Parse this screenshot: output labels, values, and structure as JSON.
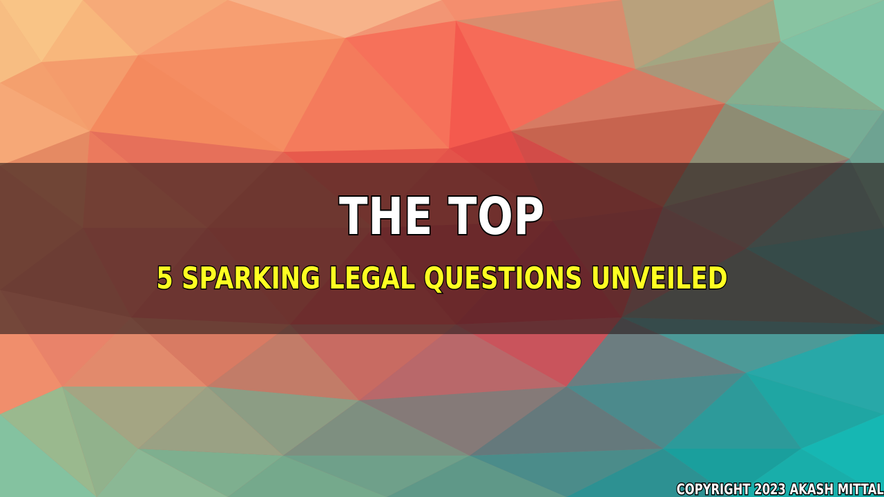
{
  "headline": {
    "title": "THE TOP",
    "subtitle": "5 SPARKING LEGAL QUESTIONS UNVEILED"
  },
  "footer": {
    "copyright": "COPYRIGHT 2023 AKASH MITTAL"
  },
  "colors": {
    "title_text": "#ffffff",
    "subtitle_text": "#ffff22",
    "text_outline": "#000000",
    "band": "#281c1c"
  }
}
